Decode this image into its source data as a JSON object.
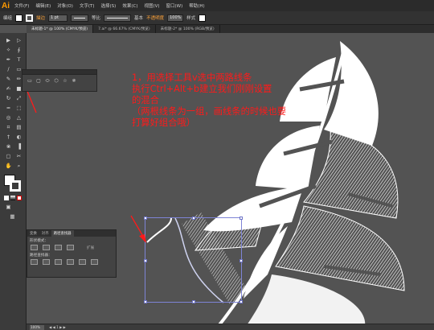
{
  "app": {
    "logo": "Ai"
  },
  "menu": [
    "文件(F)",
    "编辑(E)",
    "对象(O)",
    "文字(T)",
    "选择(S)",
    "效果(C)",
    "视图(V)",
    "窗口(W)",
    "帮助(H)"
  ],
  "control": {
    "object_label": "编组",
    "stroke_label": "描边",
    "stroke_weight": "1 pt",
    "profile_label": "等比",
    "brush_label": "基本",
    "opacity_link": "不透明度",
    "opacity_value": "100%",
    "style_label": "样式",
    "fill_color": "#ffffff",
    "stroke_color": "#ffffff"
  },
  "tabs": [
    {
      "label": "未标题-1* @ 100% (CMYK/预览)",
      "active": true
    },
    {
      "label": "7.ai* @ 66.67% (CMYK/预览)",
      "active": false
    },
    {
      "label": "未标题-2* @ 100% (RGB/预览)",
      "active": false
    }
  ],
  "instruction": {
    "color": "#ff1a1a",
    "lines": [
      "1，用选择工具v选中两路线条",
      "执行Ctrl+Alt+b建立我们刚刚设置",
      "的混合",
      "（两根线条为一组，画线条的时候也要",
      "打算好组合哦）"
    ]
  },
  "pathfinder": {
    "tabs": [
      {
        "label": "变换",
        "active": false
      },
      {
        "label": "对齐",
        "active": false
      },
      {
        "label": "路径查找器",
        "active": true
      }
    ],
    "shape_modes_label": "形状模式：",
    "expand_label": "扩展",
    "pathfinders_label": "路径查找器："
  },
  "status": {
    "zoom": "100%",
    "nav": "◀ ◀ 1 ▶ ▶"
  },
  "icons": {
    "tools": [
      "selection-icon",
      "direct-selection-icon",
      "magic-wand-icon",
      "lasso-icon",
      "pen-icon",
      "type-icon",
      "line-icon",
      "rectangle-icon",
      "paintbrush-icon",
      "pencil-icon",
      "blob-brush-icon",
      "eraser-icon",
      "rotate-icon",
      "scale-icon",
      "warp-icon",
      "free-transform-icon",
      "shape-builder-icon",
      "perspective-icon",
      "mesh-icon",
      "gradient-icon",
      "eyedropper-icon",
      "blend-icon",
      "symbol-sprayer-icon",
      "column-graph-icon",
      "artboard-icon",
      "slice-icon",
      "hand-icon",
      "zoom-icon"
    ]
  }
}
